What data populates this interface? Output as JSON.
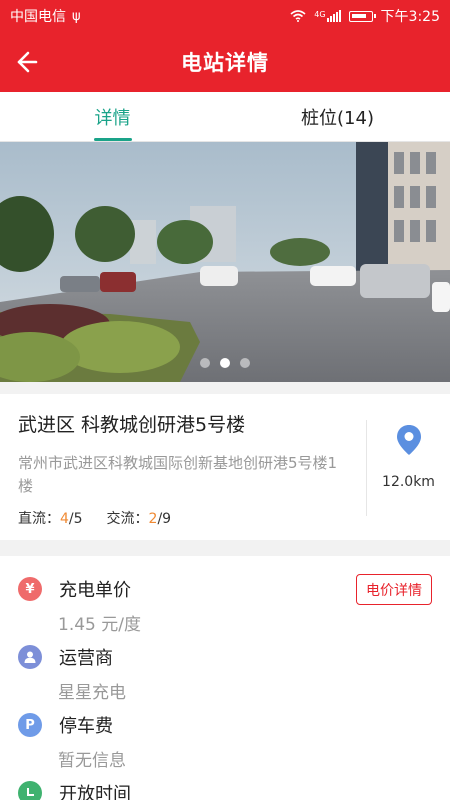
{
  "status_bar": {
    "carrier": "中国电信",
    "network": "4G",
    "time": "下午3:25"
  },
  "header": {
    "title": "电站详情"
  },
  "tabs": [
    {
      "label": "详情",
      "active": true
    },
    {
      "label": "桩位(14)",
      "active": false
    }
  ],
  "carousel": {
    "count": 3,
    "active_index": 1
  },
  "station": {
    "name": "武进区 科教城创研港5号楼",
    "address": "常州市武进区科教城国际创新基地创研港5号楼1楼",
    "dc_label": "直流：",
    "dc_available": "4",
    "dc_total": "/5",
    "ac_label": "交流：",
    "ac_available": "2",
    "ac_total": "/9",
    "distance": "12.0km"
  },
  "info": {
    "price_label": "充电单价",
    "price_value": "1.45 元/度",
    "price_detail_button": "电价详情",
    "operator_label": "运营商",
    "operator_value": "星星充电",
    "parking_label": "停车费",
    "parking_value": "暂无信息",
    "hours_label": "开放时间"
  },
  "colors": {
    "brand_red": "#e8232c",
    "tab_active": "#1aa389",
    "available_orange": "#f08a34",
    "price_icon": "#ef6b6b",
    "operator_icon": "#7d8fd8",
    "parking_icon": "#6f9be8",
    "hours_icon": "#3fb26f",
    "location_icon": "#5b8fe0"
  },
  "icons": {
    "back": "back-arrow-icon",
    "location": "map-pin-icon",
    "price": "yuan-icon",
    "operator": "person-icon",
    "parking": "parking-icon",
    "hours": "clock-icon"
  }
}
